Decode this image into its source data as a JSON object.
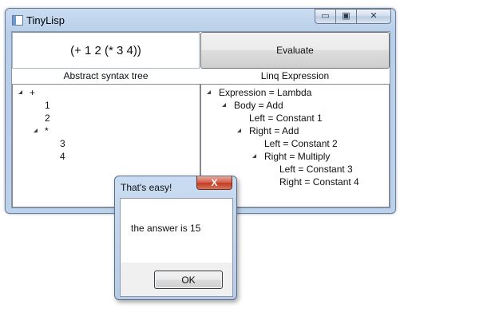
{
  "window": {
    "title": "TinyLisp",
    "icon": "app-window-icon",
    "minimize_glyph": "▭",
    "maximize_glyph": "▣",
    "close_glyph": "✕"
  },
  "expression": "(+ 1 2 (* 3 4))",
  "evaluate_label": "Evaluate",
  "ast": {
    "header": "Abstract syntax tree",
    "nodes": [
      {
        "text": "+",
        "expanded": true
      },
      {
        "text": "1"
      },
      {
        "text": "2"
      },
      {
        "text": "*",
        "expanded": true
      },
      {
        "text": "3"
      },
      {
        "text": "4"
      }
    ]
  },
  "linq": {
    "header": "Linq Expression",
    "nodes": [
      {
        "text": "Expression = Lambda",
        "expanded": true
      },
      {
        "text": "Body = Add",
        "expanded": true
      },
      {
        "text": "Left = Constant  1"
      },
      {
        "text": "Right = Add",
        "expanded": true
      },
      {
        "text": "Left = Constant  2"
      },
      {
        "text": "Right = Multiply",
        "expanded": true
      },
      {
        "text": "Left = Constant  3"
      },
      {
        "text": "Right = Constant  4"
      }
    ]
  },
  "dialog": {
    "title": "That's easy!",
    "close_glyph": "X",
    "message": "the answer is 15",
    "ok_label": "OK"
  }
}
